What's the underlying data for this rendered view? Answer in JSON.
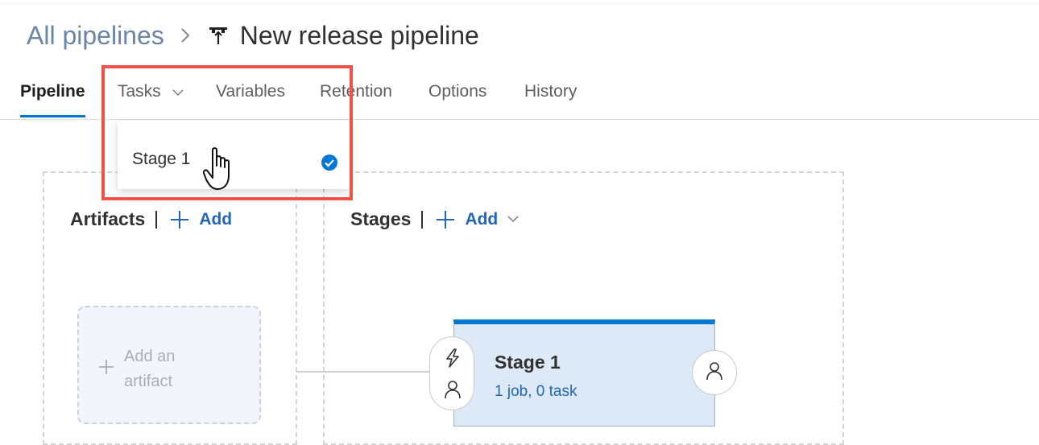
{
  "breadcrumb": {
    "root": "All pipelines",
    "separator_icon": "chevron-right-icon",
    "pipeline_icon": "release-pipeline-icon",
    "title": "New release pipeline"
  },
  "tabs": [
    {
      "label": "Pipeline",
      "active": true
    },
    {
      "label": "Tasks",
      "active": false,
      "icon": "chevron-down-icon"
    },
    {
      "label": "Variables",
      "active": false
    },
    {
      "label": "Retention",
      "active": false
    },
    {
      "label": "Options",
      "active": false
    },
    {
      "label": "History",
      "active": false
    }
  ],
  "tasks_dropdown": {
    "items": [
      {
        "label": "Stage 1",
        "selected": true,
        "icon": "checkmark-circle-icon"
      }
    ]
  },
  "artifacts": {
    "title": "Artifacts",
    "add_label": "Add",
    "placeholder": {
      "line1": "Add an",
      "line2": "artifact"
    }
  },
  "stages": {
    "title": "Stages",
    "add_label": "Add",
    "items": [
      {
        "name": "Stage 1",
        "summary": "1 job, 0 task"
      }
    ]
  },
  "colors": {
    "accent": "#0078d4",
    "link": "#2266b8",
    "highlight": "#f0524a",
    "stage_bg": "#dde9f6"
  }
}
